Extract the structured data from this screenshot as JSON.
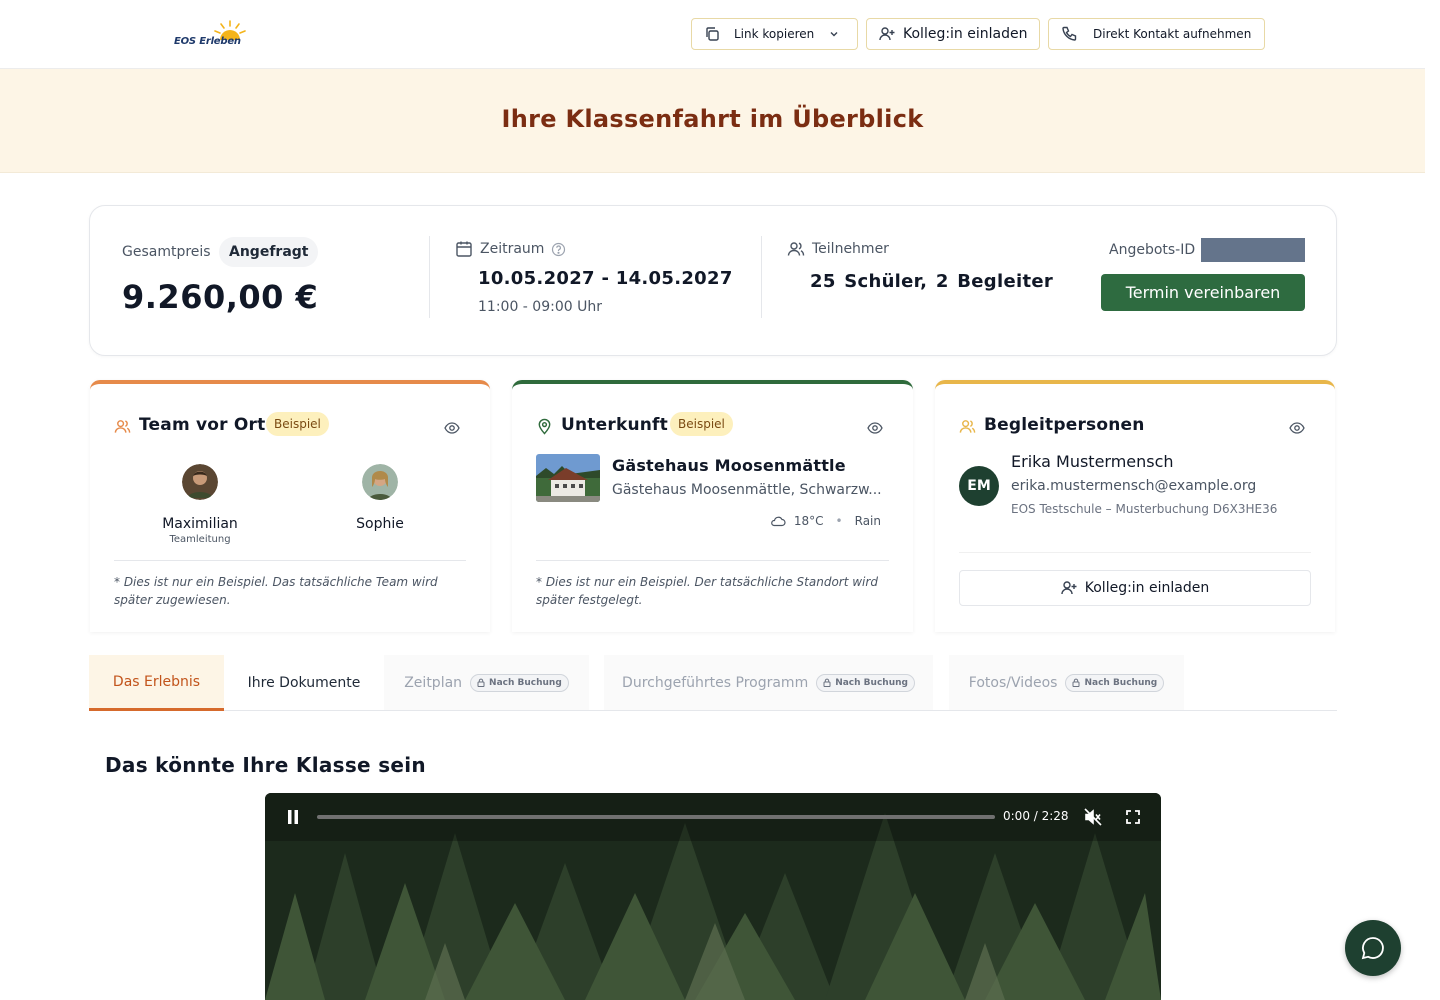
{
  "header": {
    "logo_text": "EOS Erleben",
    "copy_link_label": "Link kopieren",
    "invite_label": "Kolleg:in einladen",
    "contact_label": "Direkt Kontakt aufnehmen"
  },
  "hero": {
    "title": "Ihre Klassenfahrt im Überblick"
  },
  "summary": {
    "price_label": "Gesamtpreis",
    "status_badge": "Angefragt",
    "price": "9.260,00 €",
    "period_label": "Zeitraum",
    "dates": "10.05.2027 - 14.05.2027",
    "time": "11:00 - 09:00 Uhr",
    "participants_label": "Teilnehmer",
    "participants": "25 Schüler,  2 Begleiter",
    "offer_id_label": "Angebots-ID",
    "cta_label": "Termin vereinbaren"
  },
  "team_card": {
    "title": "Team vor Ort",
    "badge": "Beispiel",
    "members": [
      {
        "name": "Maximilian",
        "role": "Teamleitung"
      },
      {
        "name": "Sophie",
        "role": ""
      }
    ],
    "note": "* Dies ist nur ein Beispiel. Das tatsächliche Team wird später zugewiesen."
  },
  "accommodation_card": {
    "title": "Unterkunft",
    "badge": "Beispiel",
    "name": "Gästehaus Moosenmättle",
    "address": "Gästehaus Moosenmättle, Schwarzw...",
    "temperature": "18°C",
    "weather": "Rain",
    "note": "* Dies ist nur ein Beispiel. Der tatsächliche Standort wird später festgelegt."
  },
  "companions_card": {
    "title": "Begleitpersonen",
    "initials": "EM",
    "name": "Erika Mustermensch",
    "email": "erika.mustermensch@example.org",
    "school": "EOS Testschule – Musterbuchung D6X3HE36",
    "invite_label": "Kolleg:in einladen"
  },
  "tabs": {
    "experience": "Das Erlebnis",
    "documents": "Ihre Dokumente",
    "schedule": "Zeitplan",
    "program": "Durchgeführtes Programm",
    "photos": "Fotos/Videos",
    "locked_badge": "Nach Buchung"
  },
  "video_section": {
    "title": "Das könnte Ihre Klasse sein",
    "time": "0:00 / 2:28",
    "progress_fraction": 0
  },
  "colors": {
    "brand_green": "#2e6b40",
    "dark_green": "#1e4030",
    "hero_title": "#7b2d12",
    "accent_orange": "#d66a2c",
    "hero_bg": "#fdf5e6"
  }
}
